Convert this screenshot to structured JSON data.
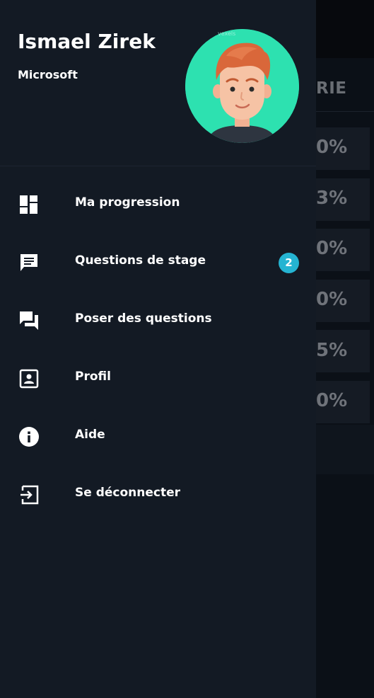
{
  "background": {
    "header_fragment": "RIE",
    "percentages": [
      "0%",
      "3%",
      "0%",
      "0%",
      "5%",
      "0%"
    ]
  },
  "drawer": {
    "user": {
      "name": "Ismael Zirek",
      "company": "Microsoft",
      "avatar_icon": "avatar-illustration",
      "watermark": "vexels"
    },
    "menu": [
      {
        "label": "Ma progression",
        "icon": "dashboard-icon"
      },
      {
        "label": "Questions de stage",
        "icon": "message-icon",
        "badge": "2"
      },
      {
        "label": "Poser des questions",
        "icon": "forum-icon"
      },
      {
        "label": "Profil",
        "icon": "contact-card-icon"
      },
      {
        "label": "Aide",
        "icon": "info-icon"
      },
      {
        "label": "Se déconnecter",
        "icon": "logout-icon"
      }
    ]
  },
  "colors": {
    "drawer_bg": "#131a24",
    "avatar_bg": "#2de1b0",
    "badge_bg": "#25b4d2"
  }
}
